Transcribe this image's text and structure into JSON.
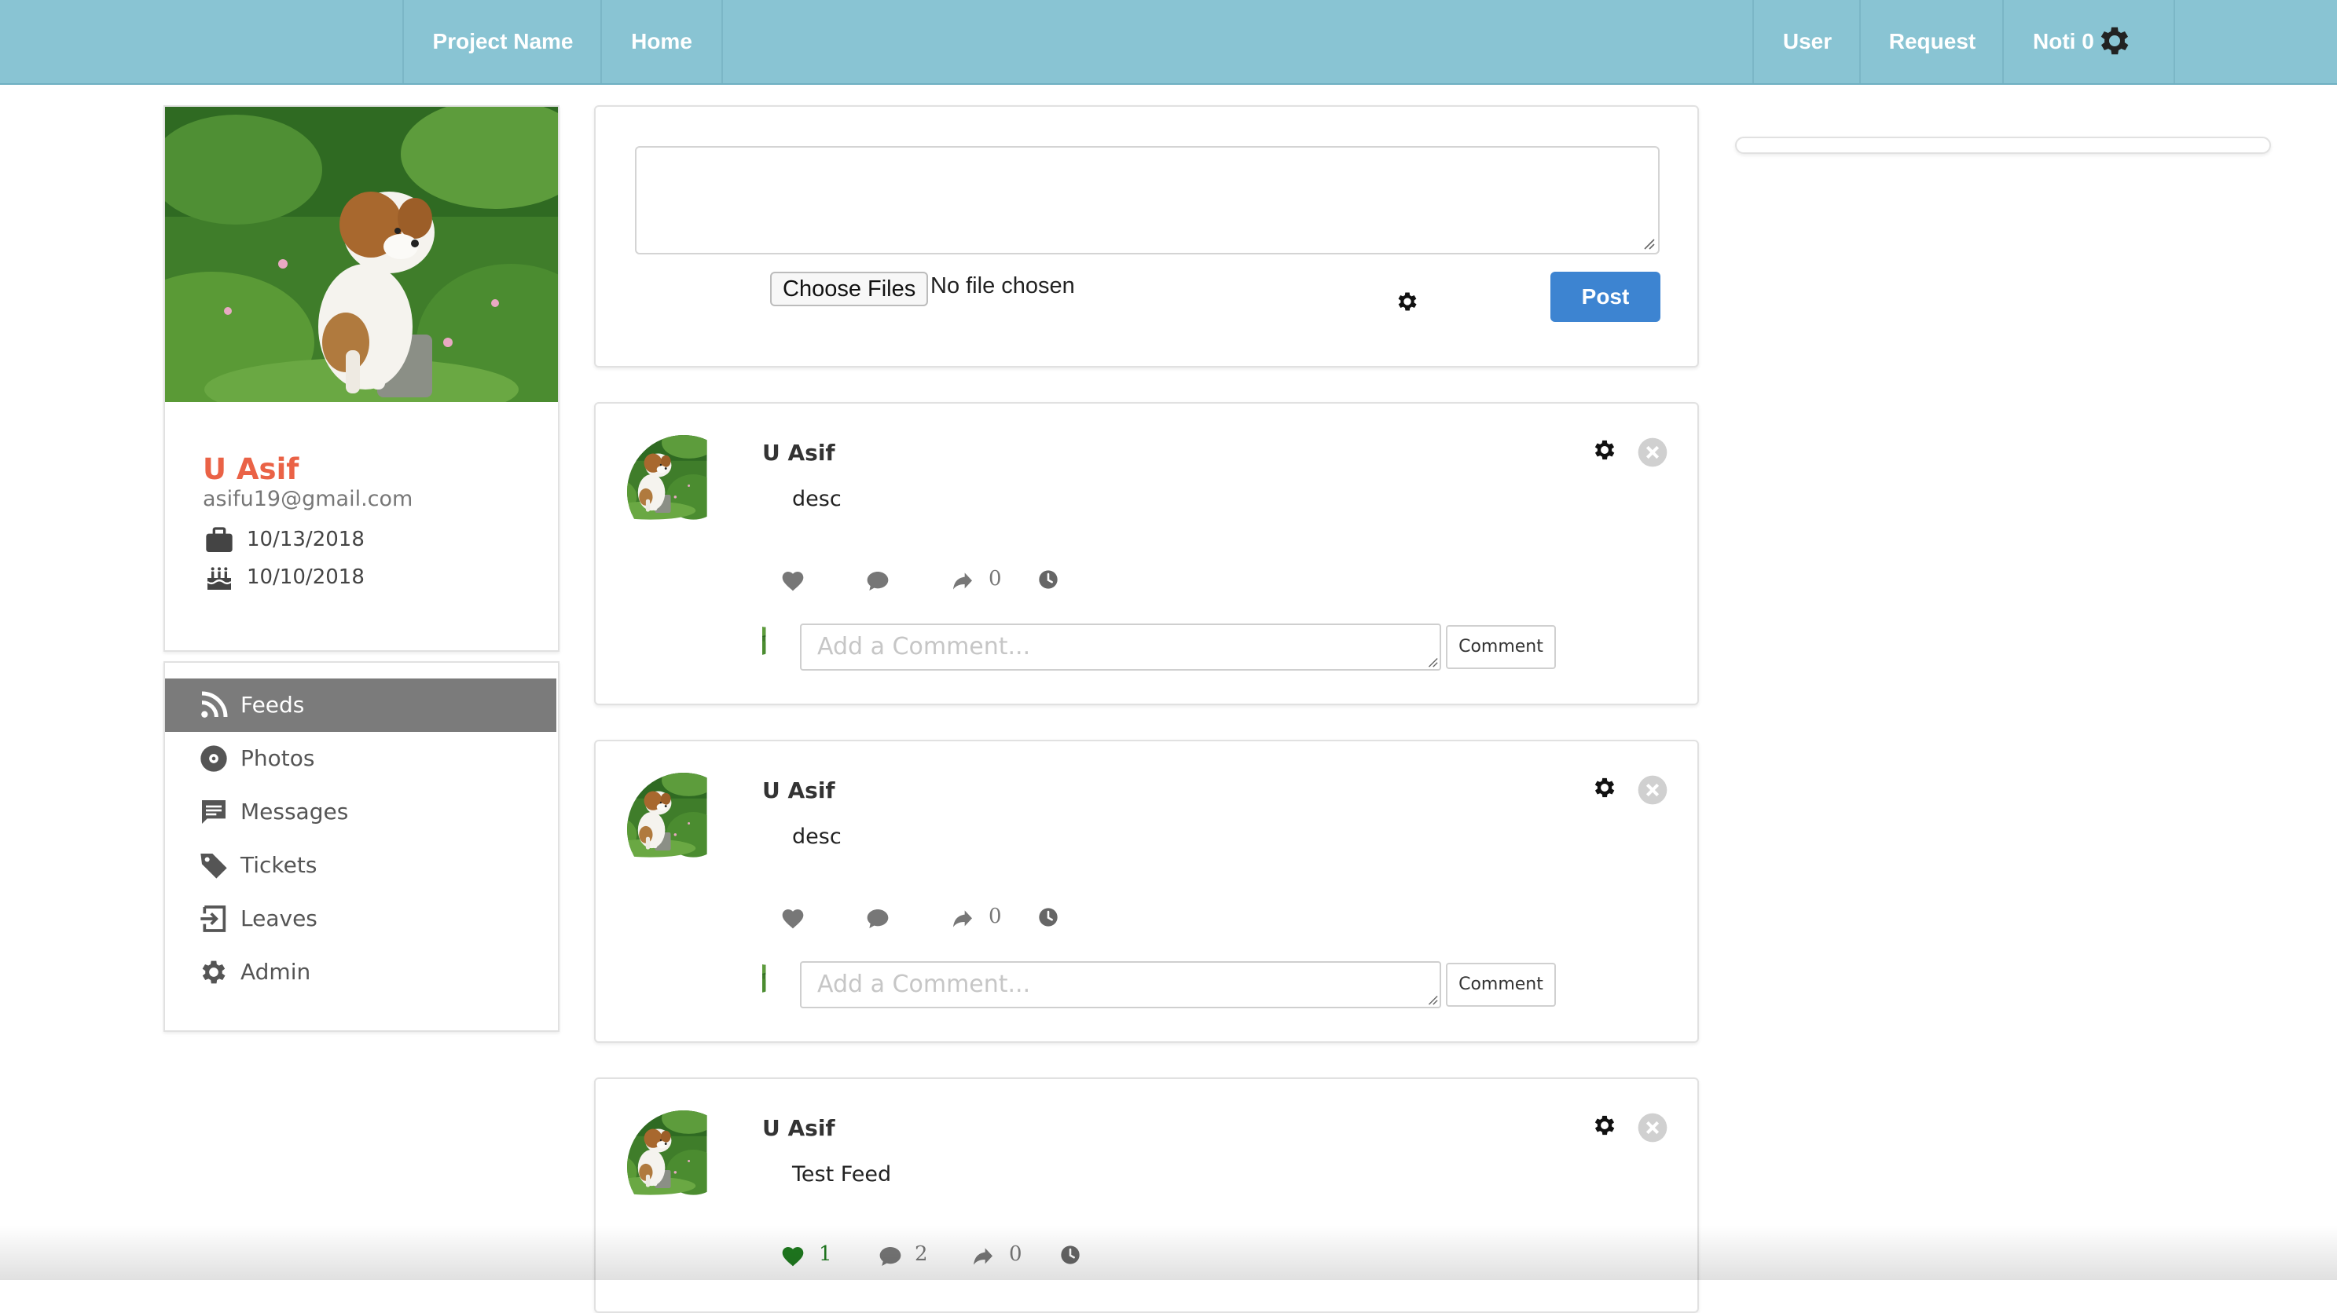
{
  "navbar": {
    "brand": "Project Name",
    "home": "Home",
    "user": "User",
    "request": "Request",
    "noti": "Noti 0",
    "settings_icon": "gear-icon",
    "background": "#89c4d3"
  },
  "profile": {
    "name": "U Asif",
    "email": "asifu19@gmail.com",
    "join_date": "10/13/2018",
    "birth_date": "10/10/2018",
    "name_color": "#ea6246"
  },
  "sidebar": {
    "items": [
      {
        "label": "Feeds",
        "icon": "rss-icon",
        "active": true
      },
      {
        "label": "Photos",
        "icon": "disc-icon",
        "active": false
      },
      {
        "label": "Messages",
        "icon": "message-icon",
        "active": false
      },
      {
        "label": "Tickets",
        "icon": "tag-icon",
        "active": false
      },
      {
        "label": "Leaves",
        "icon": "sign-in-icon",
        "active": false
      },
      {
        "label": "Admin",
        "icon": "gear-icon",
        "active": false
      }
    ]
  },
  "composer": {
    "choose_files": "Choose Files",
    "no_file": "No file chosen",
    "post_label": "Post",
    "post_color": "#3d84d1"
  },
  "posts": [
    {
      "author": "U Asif",
      "text": "desc",
      "likes": "",
      "comments": "",
      "shares": "0",
      "comment_placeholder": "Add a Comment...",
      "comment_button": "Comment"
    },
    {
      "author": "U Asif",
      "text": "desc",
      "likes": "",
      "comments": "",
      "shares": "0",
      "comment_placeholder": "Add a Comment...",
      "comment_button": "Comment"
    },
    {
      "author": "U Asif",
      "text": "Test Feed",
      "likes": "1",
      "comments": "2",
      "shares": "0",
      "liked_color": "#1f7a1f"
    }
  ]
}
